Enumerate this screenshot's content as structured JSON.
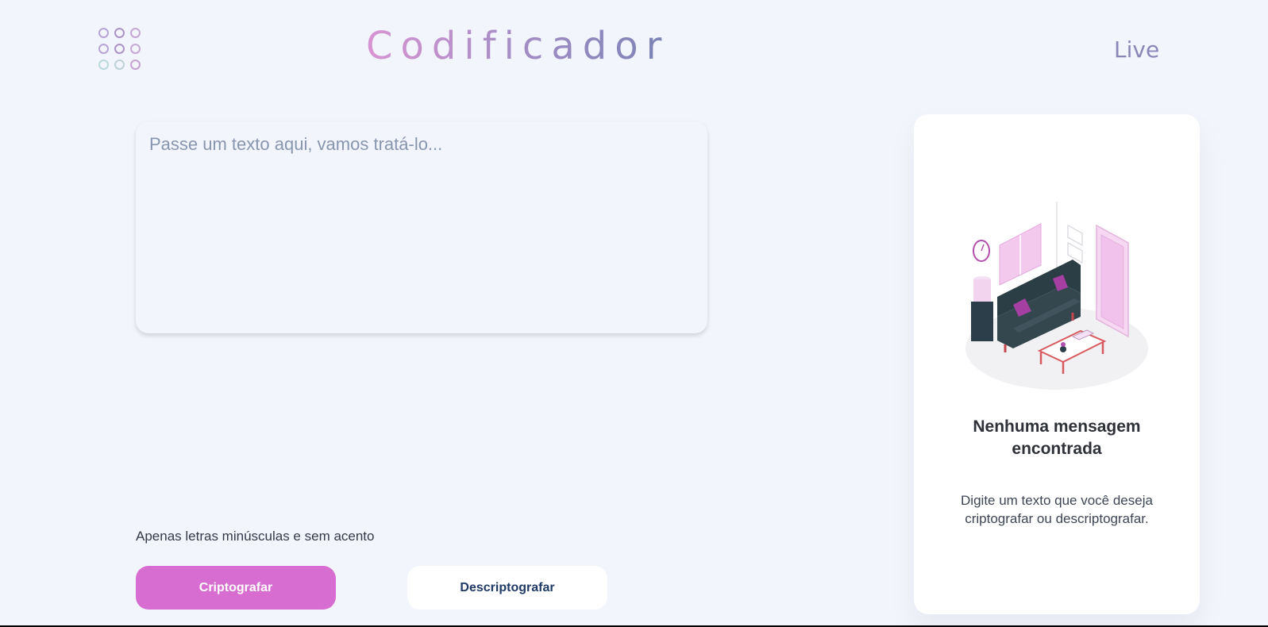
{
  "header": {
    "title": "Codificador",
    "live_link": "Live"
  },
  "input": {
    "placeholder": "Passe um texto aqui, vamos tratá-lo...",
    "value": ""
  },
  "hint": {
    "text": "Apenas letras minúsculas e sem acento",
    "icon": "info-icon"
  },
  "actions": {
    "encrypt_label": "Criptografar",
    "decrypt_label": "Descriptografar"
  },
  "output_panel": {
    "title": "Nenhuma mensagem encontrada",
    "description": "Digite um texto que você deseja criptografar ou descriptografar."
  },
  "colors": {
    "background": "#f3f5fc",
    "primary_button": "#d76dd0",
    "secondary_button": "#ffffff",
    "secondary_text": "#1f3a66"
  }
}
